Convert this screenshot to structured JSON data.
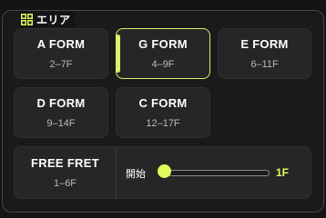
{
  "section": {
    "title": "エリア",
    "icon": "grid-icon",
    "accent_color": "#e2fb5f"
  },
  "cards": [
    {
      "id": "a",
      "title": "A FORM",
      "range": "2–7F",
      "active": false
    },
    {
      "id": "g",
      "title": "G FORM",
      "range": "4–9F",
      "active": true
    },
    {
      "id": "e",
      "title": "E FORM",
      "range": "6–11F",
      "active": false
    },
    {
      "id": "d",
      "title": "D FORM",
      "range": "9–14F",
      "active": false
    },
    {
      "id": "c",
      "title": "C FORM",
      "range": "12–17F",
      "active": false
    }
  ],
  "free_fret": {
    "title": "FREE FRET",
    "range": "1–6F"
  },
  "start": {
    "label": "開始",
    "value_label": "1F",
    "slider_fraction": 0
  }
}
